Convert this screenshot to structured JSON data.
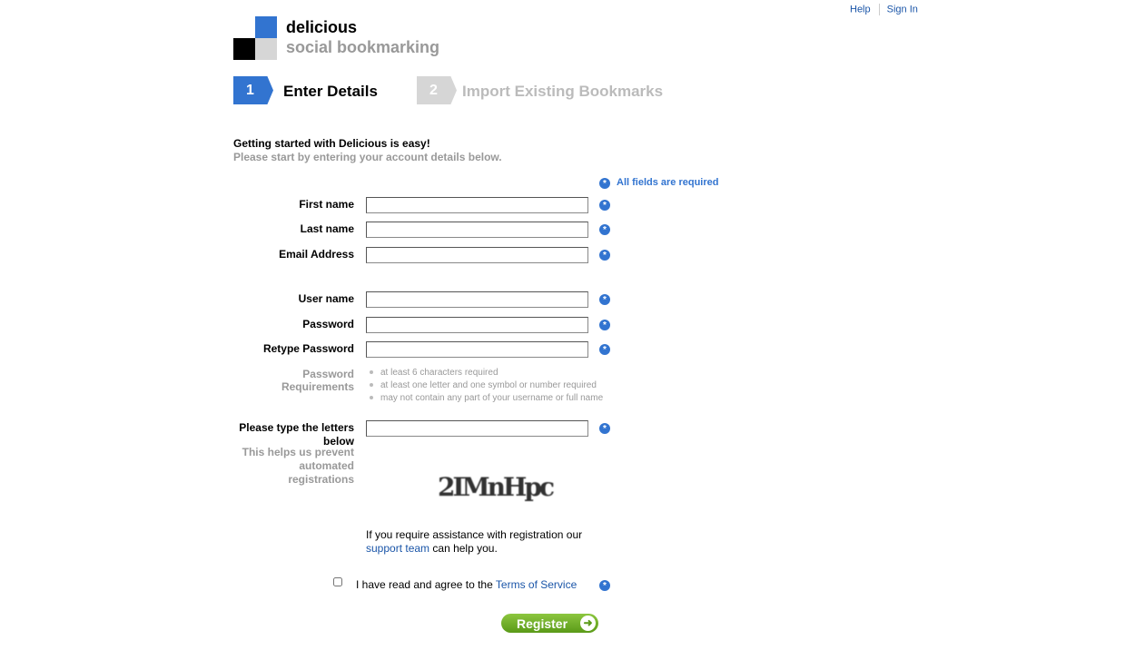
{
  "header": {
    "links": {
      "help": "Help",
      "sign_in": "Sign In"
    },
    "brand": {
      "name": "delicious",
      "tagline": "social bookmarking"
    },
    "colors": {
      "blue": "#3274d0",
      "black": "#000000",
      "grey": "#d6d6d6"
    }
  },
  "steps": [
    {
      "number": "1",
      "label": "Enter Details",
      "active": true
    },
    {
      "number": "2",
      "label": "Import Existing Bookmarks",
      "active": false
    }
  ],
  "intro": {
    "line1": "Getting started with Delicious is easy!",
    "line2": "Please start by entering your account details below."
  },
  "form": {
    "all_required": "All fields are required",
    "required_icon": "asterisk-icon",
    "fields": {
      "first_name": {
        "label": "First name",
        "value": ""
      },
      "last_name": {
        "label": "Last name",
        "value": ""
      },
      "email": {
        "label": "Email Address",
        "value": ""
      },
      "username": {
        "label": "User name",
        "value": ""
      },
      "password": {
        "label": "Password",
        "value": ""
      },
      "retype_password": {
        "label": "Retype Password",
        "value": ""
      }
    },
    "password_requirements": {
      "label_line1": "Password",
      "label_line2": "Requirements",
      "items": [
        "at least 6 characters required",
        "at least one letter and one symbol or number required",
        "may not contain any part of your username or full name"
      ]
    },
    "captcha": {
      "label_line1": "Please type the letters",
      "label_line2": "below",
      "help_line1": "This helps us prevent",
      "help_line2": "automated",
      "help_line3": "registrations",
      "image_text": "2IMnHpc",
      "value": ""
    },
    "assistance": {
      "prefix": "If you require assistance with registration our",
      "link": "support team",
      "suffix": "can help you."
    },
    "agree": {
      "prefix": "I have read and agree to the",
      "link": "Terms of Service",
      "checked": false
    },
    "register_label": "Register",
    "register_color": "#6aab24"
  }
}
